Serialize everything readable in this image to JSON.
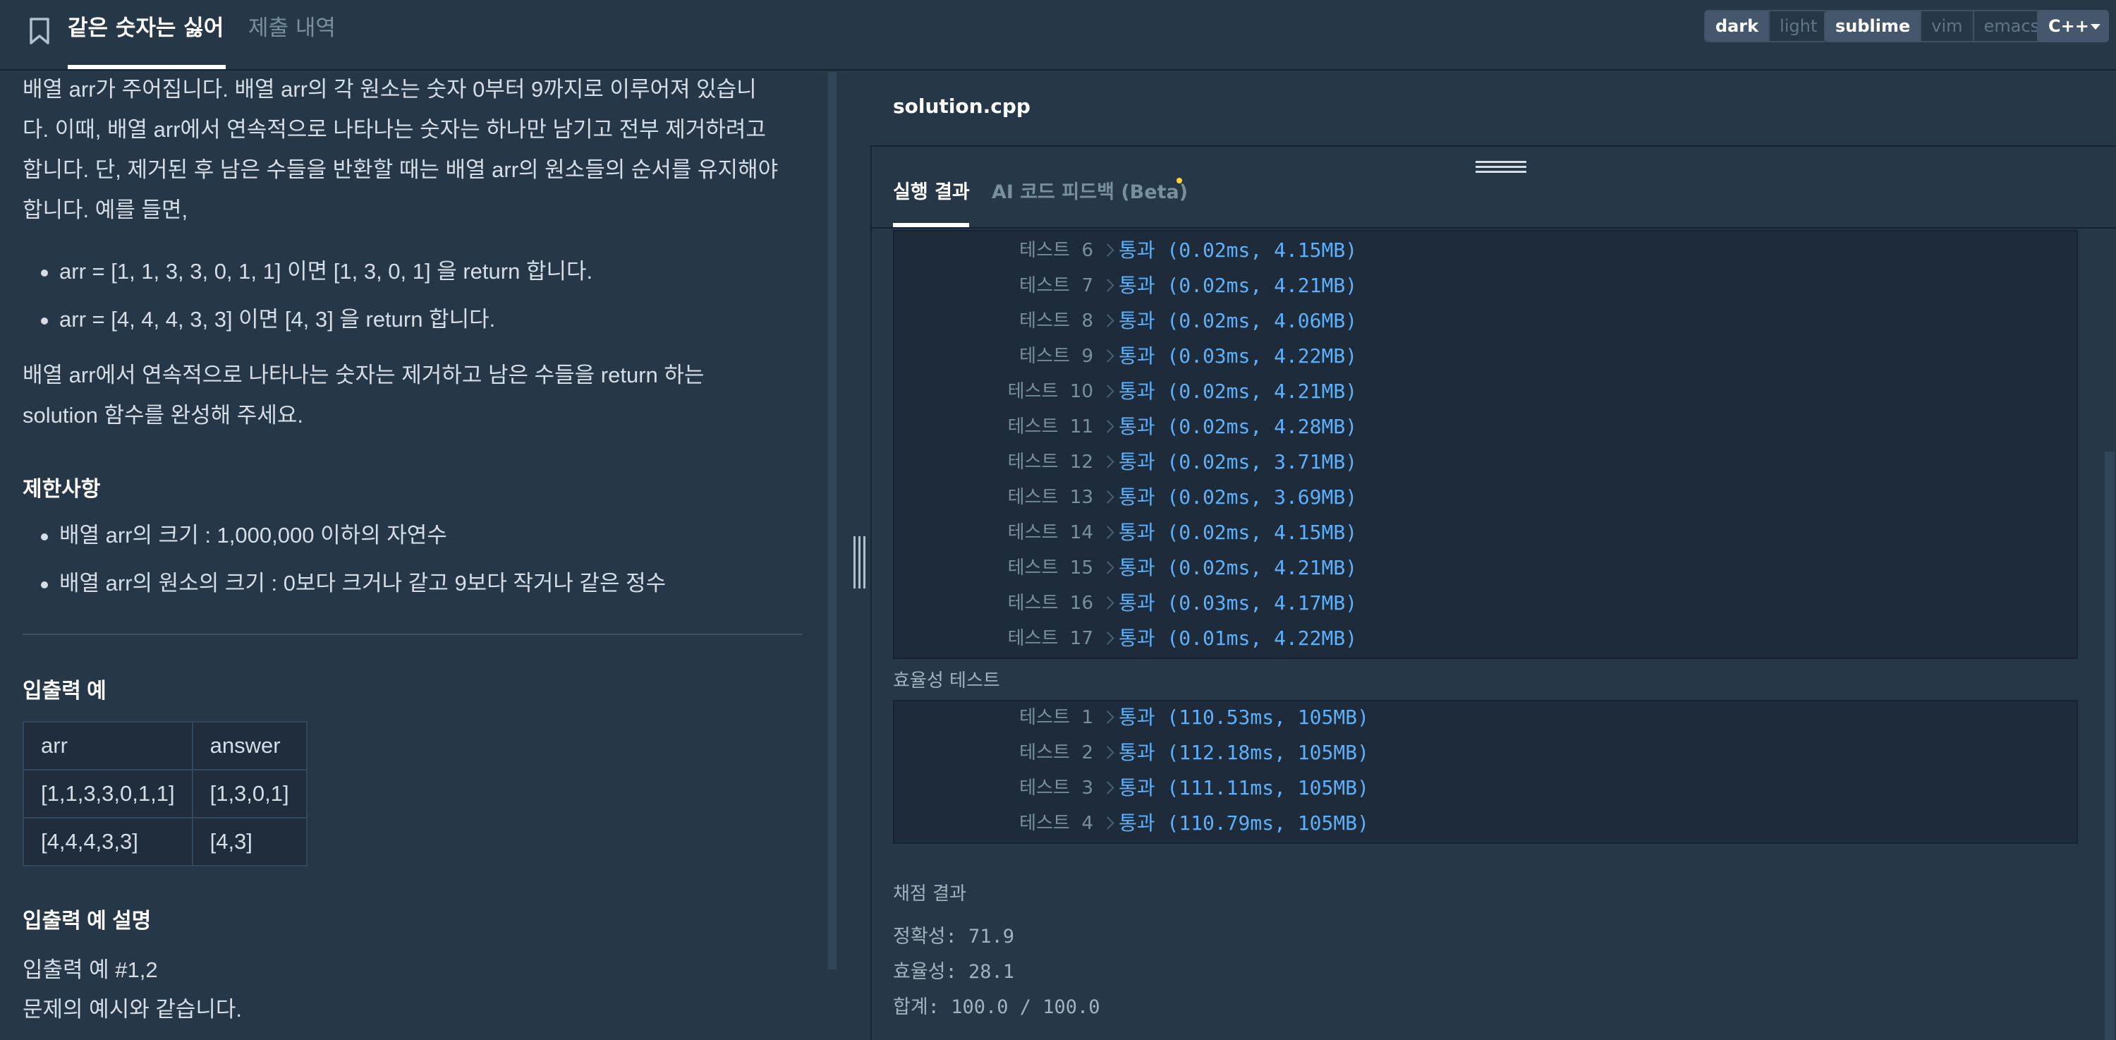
{
  "header": {
    "active_tab": "같은 숫자는 싫어",
    "inactive_tab": "제출 내역",
    "theme_options": [
      "dark",
      "light"
    ],
    "theme_selected": "dark",
    "keymap_options": [
      "sublime",
      "vim",
      "emacs"
    ],
    "keymap_selected": "sublime",
    "language": "C++"
  },
  "problem": {
    "description_lines": [
      "배열 arr가 주어집니다. 배열 arr의 각 원소는 숫자 0부터 9까지로 이루어져 있습니",
      "다. 이때, 배열 arr에서 연속적으로 나타나는 숫자는 하나만 남기고 전부 제거하려고",
      "합니다. 단, 제거된 후 남은 수들을 반환할 때는 배열 arr의 원소들의 순서를 유지해야",
      "합니다. 예를 들면,"
    ],
    "examples": [
      "arr = [1, 1, 3, 3, 0, 1, 1] 이면 [1, 3, 0, 1] 을 return 합니다.",
      "arr = [4, 4, 4, 3, 3] 이면 [4, 3] 을 return 합니다."
    ],
    "task_lines": [
      "배열 arr에서 연속적으로 나타나는 숫자는 제거하고 남은 수들을 return 하는",
      "solution 함수를 완성해 주세요."
    ],
    "constraints_title": "제한사항",
    "constraints": [
      "배열 arr의 크기 : 1,000,000 이하의 자연수",
      "배열 arr의 원소의 크기 : 0보다 크거나 같고 9보다 작거나 같은 정수"
    ],
    "io_title": "입출력 예",
    "io_headers": [
      "arr",
      "answer"
    ],
    "io_rows": [
      [
        "[1,1,3,3,0,1,1]",
        "[1,3,0,1]"
      ],
      [
        "[4,4,4,3,3]",
        "[4,3]"
      ]
    ],
    "io_explain_title": "입출력 예 설명",
    "io_explain_lines": [
      "입출력 예 #1,2",
      "문제의 예시와 같습니다."
    ]
  },
  "editor": {
    "file_name": "solution.cpp"
  },
  "results": {
    "tab_run": "실행 결과",
    "tab_ai": "AI 코드 피드백 (Beta)",
    "accuracy_tests": [
      {
        "label": "테스트  6",
        "result": "통과 (0.02ms, 4.15MB)"
      },
      {
        "label": "테스트  7",
        "result": "통과 (0.02ms, 4.21MB)"
      },
      {
        "label": "테스트  8",
        "result": "통과 (0.02ms, 4.06MB)"
      },
      {
        "label": "테스트  9",
        "result": "통과 (0.03ms, 4.22MB)"
      },
      {
        "label": "테스트  10",
        "result": "통과 (0.02ms, 4.21MB)"
      },
      {
        "label": "테스트  11",
        "result": "통과 (0.02ms, 4.28MB)"
      },
      {
        "label": "테스트  12",
        "result": "통과 (0.02ms, 3.71MB)"
      },
      {
        "label": "테스트  13",
        "result": "통과 (0.02ms, 3.69MB)"
      },
      {
        "label": "테스트  14",
        "result": "통과 (0.02ms, 4.15MB)"
      },
      {
        "label": "테스트  15",
        "result": "통과 (0.02ms, 4.21MB)"
      },
      {
        "label": "테스트  16",
        "result": "통과 (0.03ms, 4.17MB)"
      },
      {
        "label": "테스트  17",
        "result": "통과 (0.01ms, 4.22MB)"
      }
    ],
    "efficiency_label": "효율성  테스트",
    "efficiency_tests": [
      {
        "label": "테스트  1",
        "result": "통과 (110.53ms, 105MB)"
      },
      {
        "label": "테스트  2",
        "result": "통과 (112.18ms, 105MB)"
      },
      {
        "label": "테스트  3",
        "result": "통과 (111.11ms, 105MB)"
      },
      {
        "label": "테스트  4",
        "result": "통과 (110.79ms, 105MB)"
      }
    ],
    "grading_label": "채점  결과",
    "accuracy_score": "정확성: 71.9",
    "efficiency_score": "효율성: 28.1",
    "total_score": "합계: 100.0 / 100.0"
  }
}
